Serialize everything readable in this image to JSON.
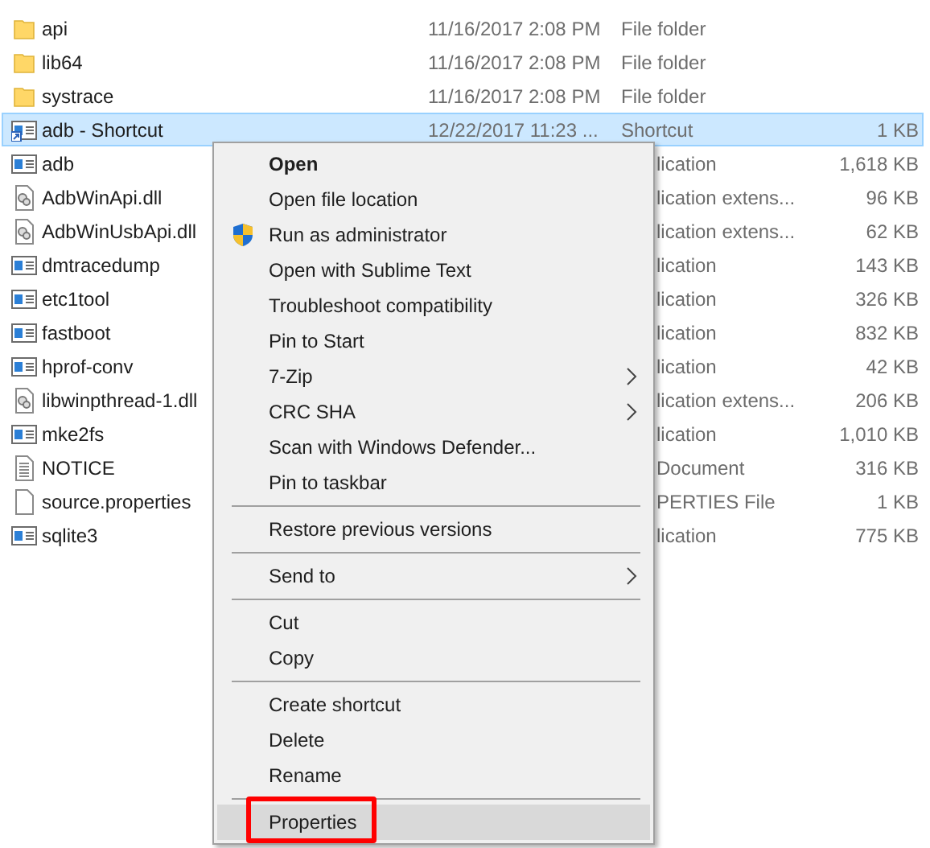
{
  "files": [
    {
      "name": "api",
      "date": "11/16/2017 2:08 PM",
      "type": "File folder",
      "kind": "folder",
      "selected": false
    },
    {
      "name": "lib64",
      "date": "11/16/2017 2:08 PM",
      "type": "File folder",
      "kind": "folder",
      "selected": false
    },
    {
      "name": "systrace",
      "date": "11/16/2017 2:08 PM",
      "type": "File folder",
      "kind": "folder",
      "selected": false
    },
    {
      "name": "adb - Shortcut",
      "date": "12/22/2017 11:23 ...",
      "type": "Shortcut",
      "size": "1 KB",
      "kind": "shortcut",
      "selected": true
    },
    {
      "name": "adb",
      "type": "lication",
      "size": "1,618 KB",
      "kind": "app",
      "selected": false
    },
    {
      "name": "AdbWinApi.dll",
      "type": "lication extens...",
      "size": "96 KB",
      "kind": "dll",
      "selected": false
    },
    {
      "name": "AdbWinUsbApi.dll",
      "type": "lication extens...",
      "size": "62 KB",
      "kind": "dll",
      "selected": false
    },
    {
      "name": "dmtracedump",
      "type": "lication",
      "size": "143 KB",
      "kind": "app",
      "selected": false
    },
    {
      "name": "etc1tool",
      "type": "lication",
      "size": "326 KB",
      "kind": "app",
      "selected": false
    },
    {
      "name": "fastboot",
      "type": "lication",
      "size": "832 KB",
      "kind": "app",
      "selected": false
    },
    {
      "name": "hprof-conv",
      "type": "lication",
      "size": "42 KB",
      "kind": "app",
      "selected": false
    },
    {
      "name": "libwinpthread-1.dll",
      "type": "lication extens...",
      "size": "206 KB",
      "kind": "dll",
      "selected": false
    },
    {
      "name": "mke2fs",
      "type": "lication",
      "size": "1,010 KB",
      "kind": "app",
      "selected": false
    },
    {
      "name": "NOTICE",
      "type": "Document",
      "size": "316 KB",
      "kind": "text",
      "selected": false
    },
    {
      "name": "source.properties",
      "type": "PERTIES File",
      "size": "1 KB",
      "kind": "blank",
      "selected": false
    },
    {
      "name": "sqlite3",
      "type": "lication",
      "size": "775 KB",
      "kind": "app",
      "selected": false
    }
  ],
  "context_menu": [
    {
      "kind": "item",
      "label": "Open",
      "bold": true
    },
    {
      "kind": "item",
      "label": "Open file location"
    },
    {
      "kind": "item",
      "label": "Run as administrator",
      "shield": true
    },
    {
      "kind": "item",
      "label": "Open with Sublime Text"
    },
    {
      "kind": "item",
      "label": "Troubleshoot compatibility"
    },
    {
      "kind": "item",
      "label": "Pin to Start"
    },
    {
      "kind": "item",
      "label": "7-Zip",
      "submenu": true
    },
    {
      "kind": "item",
      "label": "CRC SHA",
      "submenu": true
    },
    {
      "kind": "item",
      "label": "Scan with Windows Defender..."
    },
    {
      "kind": "item",
      "label": "Pin to taskbar"
    },
    {
      "kind": "separator"
    },
    {
      "kind": "item",
      "label": "Restore previous versions"
    },
    {
      "kind": "separator"
    },
    {
      "kind": "item",
      "label": "Send to",
      "submenu": true
    },
    {
      "kind": "separator"
    },
    {
      "kind": "item",
      "label": "Cut"
    },
    {
      "kind": "item",
      "label": "Copy"
    },
    {
      "kind": "separator"
    },
    {
      "kind": "item",
      "label": "Create shortcut"
    },
    {
      "kind": "item",
      "label": "Delete"
    },
    {
      "kind": "item",
      "label": "Rename"
    },
    {
      "kind": "separator"
    },
    {
      "kind": "item",
      "label": "Properties",
      "highlighted": true,
      "outlined": true
    }
  ]
}
